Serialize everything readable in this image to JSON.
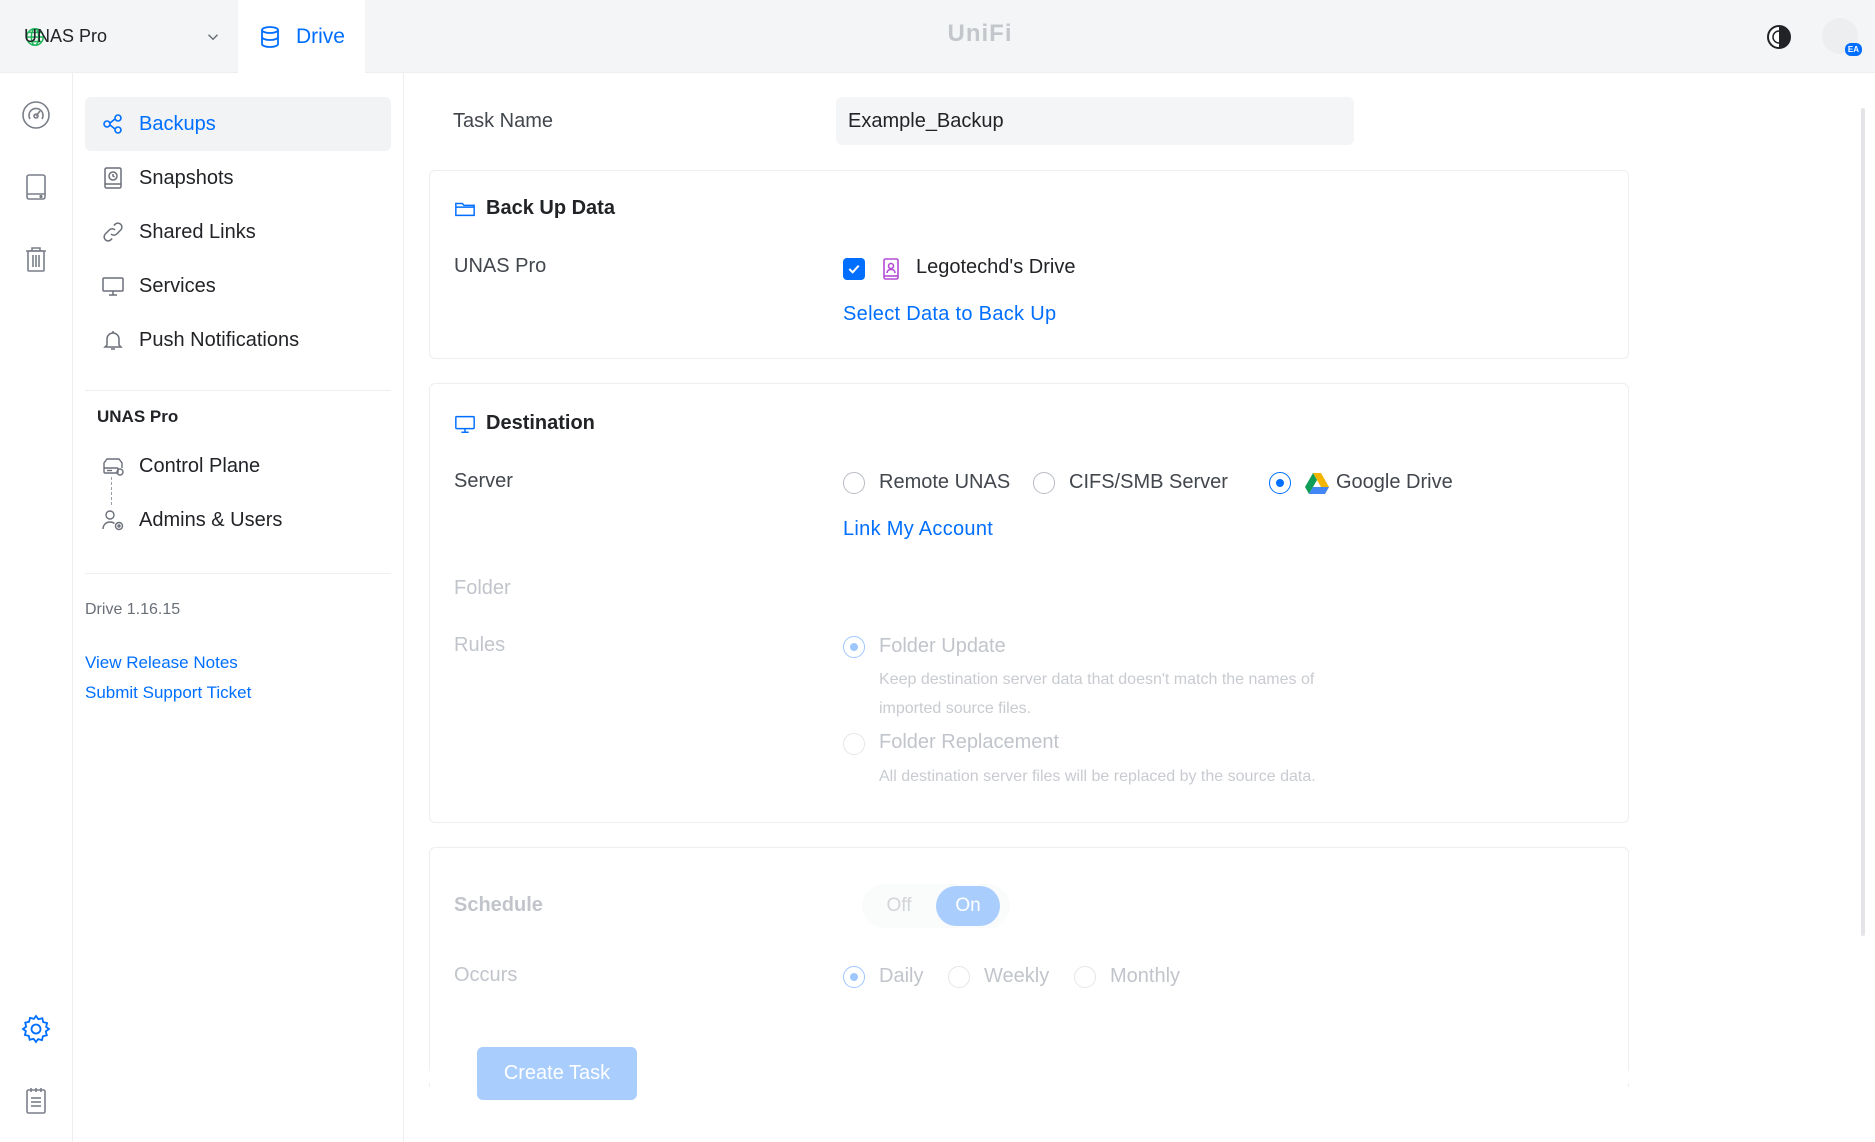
{
  "topbar": {
    "site_name": "UNAS Pro",
    "app_tab": "Drive",
    "brand": "UniFi",
    "avatar_badge": "EA"
  },
  "rail": {
    "icons": [
      "dashboard-icon",
      "drive-icon",
      "trash-icon",
      "settings-icon",
      "logs-icon"
    ]
  },
  "sidebar": {
    "items": [
      {
        "label": "Backups",
        "icon": "backups-icon",
        "active": true
      },
      {
        "label": "Snapshots",
        "icon": "snapshots-icon"
      },
      {
        "label": "Shared Links",
        "icon": "link-icon"
      },
      {
        "label": "Services",
        "icon": "monitor-icon"
      },
      {
        "label": "Push Notifications",
        "icon": "bell-icon"
      }
    ],
    "section_title": "UNAS Pro",
    "section_items": [
      {
        "label": "Control Plane",
        "icon": "control-plane-icon"
      },
      {
        "label": "Admins & Users",
        "icon": "users-icon"
      }
    ],
    "version": "Drive 1.16.15",
    "links": [
      "View Release Notes",
      "Submit Support Ticket"
    ]
  },
  "form": {
    "task_name_label": "Task Name",
    "task_name_value": "Example_Backup",
    "backup_card": {
      "title": "Back Up Data",
      "source_label": "UNAS Pro",
      "drive_name": "Legotechd's Drive",
      "select_link": "Select Data to Back Up"
    },
    "destination_card": {
      "title": "Destination",
      "server_label": "Server",
      "server_options": [
        "Remote UNAS",
        "CIFS/SMB Server",
        "Google Drive"
      ],
      "selected_server": "Google Drive",
      "link_account": "Link My Account",
      "folder_label": "Folder",
      "rules_label": "Rules",
      "rules": [
        {
          "title": "Folder Update",
          "desc": "Keep destination server data that doesn't match the names of imported source files."
        },
        {
          "title": "Folder Replacement",
          "desc": "All destination server files will be replaced by the source data."
        }
      ]
    },
    "schedule_card": {
      "schedule_label": "Schedule",
      "toggle_off": "Off",
      "toggle_on": "On",
      "occurs_label": "Occurs",
      "occurs_options": [
        "Daily",
        "Weekly",
        "Monthly"
      ],
      "selected_occurs": "Daily"
    },
    "create_button": "Create Task"
  },
  "colors": {
    "accent": "#006fff",
    "accent_disabled": "#a9cdfd",
    "google_green": "#0f9d58",
    "google_yellow": "#f4b400",
    "google_blue": "#4285f4"
  }
}
